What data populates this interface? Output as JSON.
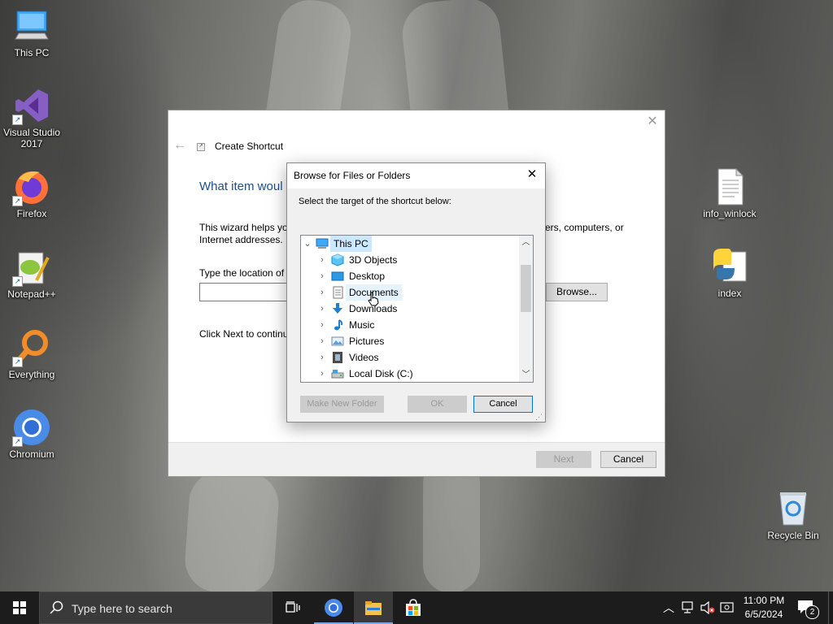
{
  "desktop": {
    "icons_left": [
      {
        "label": "This PC",
        "icon": "this-pc-icon"
      },
      {
        "label": "Visual Studio\n2017",
        "icon": "visual-studio-icon"
      },
      {
        "label": "Firefox",
        "icon": "firefox-icon"
      },
      {
        "label": "Notepad++",
        "icon": "notepad-plus-plus-icon"
      },
      {
        "label": "Everything",
        "icon": "everything-search-icon"
      },
      {
        "label": "Chromium",
        "icon": "chromium-icon"
      }
    ],
    "icons_right": [
      {
        "label": "info_winlock",
        "icon": "text-file-icon"
      },
      {
        "label": "index",
        "icon": "python-file-icon"
      },
      {
        "label": "Recycle Bin",
        "icon": "recycle-bin-icon"
      }
    ]
  },
  "wizard": {
    "title": "Create Shortcut",
    "heading": "What item woul",
    "description_left": "This wizard helps you",
    "description_left_2": "Internet addresses.",
    "description_right": "ers, computers, or",
    "location_label": "Type the location of t",
    "location_value": "",
    "browse_label": "Browse...",
    "next_hint": "Click Next to continu",
    "next_label": "Next",
    "cancel_label": "Cancel"
  },
  "browse_dialog": {
    "title": "Browse for Files or Folders",
    "instruction": "Select the target of the shortcut below:",
    "root": {
      "label": "This PC",
      "icon": "this-pc-icon",
      "selected": true,
      "expanded": true
    },
    "items": [
      {
        "label": "3D Objects",
        "icon": "3d-objects-icon"
      },
      {
        "label": "Desktop",
        "icon": "desktop-folder-icon"
      },
      {
        "label": "Documents",
        "icon": "documents-icon",
        "hovered": true
      },
      {
        "label": "Downloads",
        "icon": "downloads-icon"
      },
      {
        "label": "Music",
        "icon": "music-icon"
      },
      {
        "label": "Pictures",
        "icon": "pictures-icon"
      },
      {
        "label": "Videos",
        "icon": "videos-icon"
      },
      {
        "label": "Local Disk (C:)",
        "icon": "local-disk-icon"
      }
    ],
    "make_new_folder_label": "Make New Folder",
    "ok_label": "OK",
    "cancel_label": "Cancel"
  },
  "taskbar": {
    "search_placeholder": "Type here to search",
    "time": "11:00 PM",
    "date": "6/5/2024",
    "notification_count": "2"
  },
  "colors": {
    "accent": "#0078d7",
    "heading_blue": "#1e4e8c",
    "selection": "#cce8ff",
    "taskbar": "#1c1c1c"
  }
}
